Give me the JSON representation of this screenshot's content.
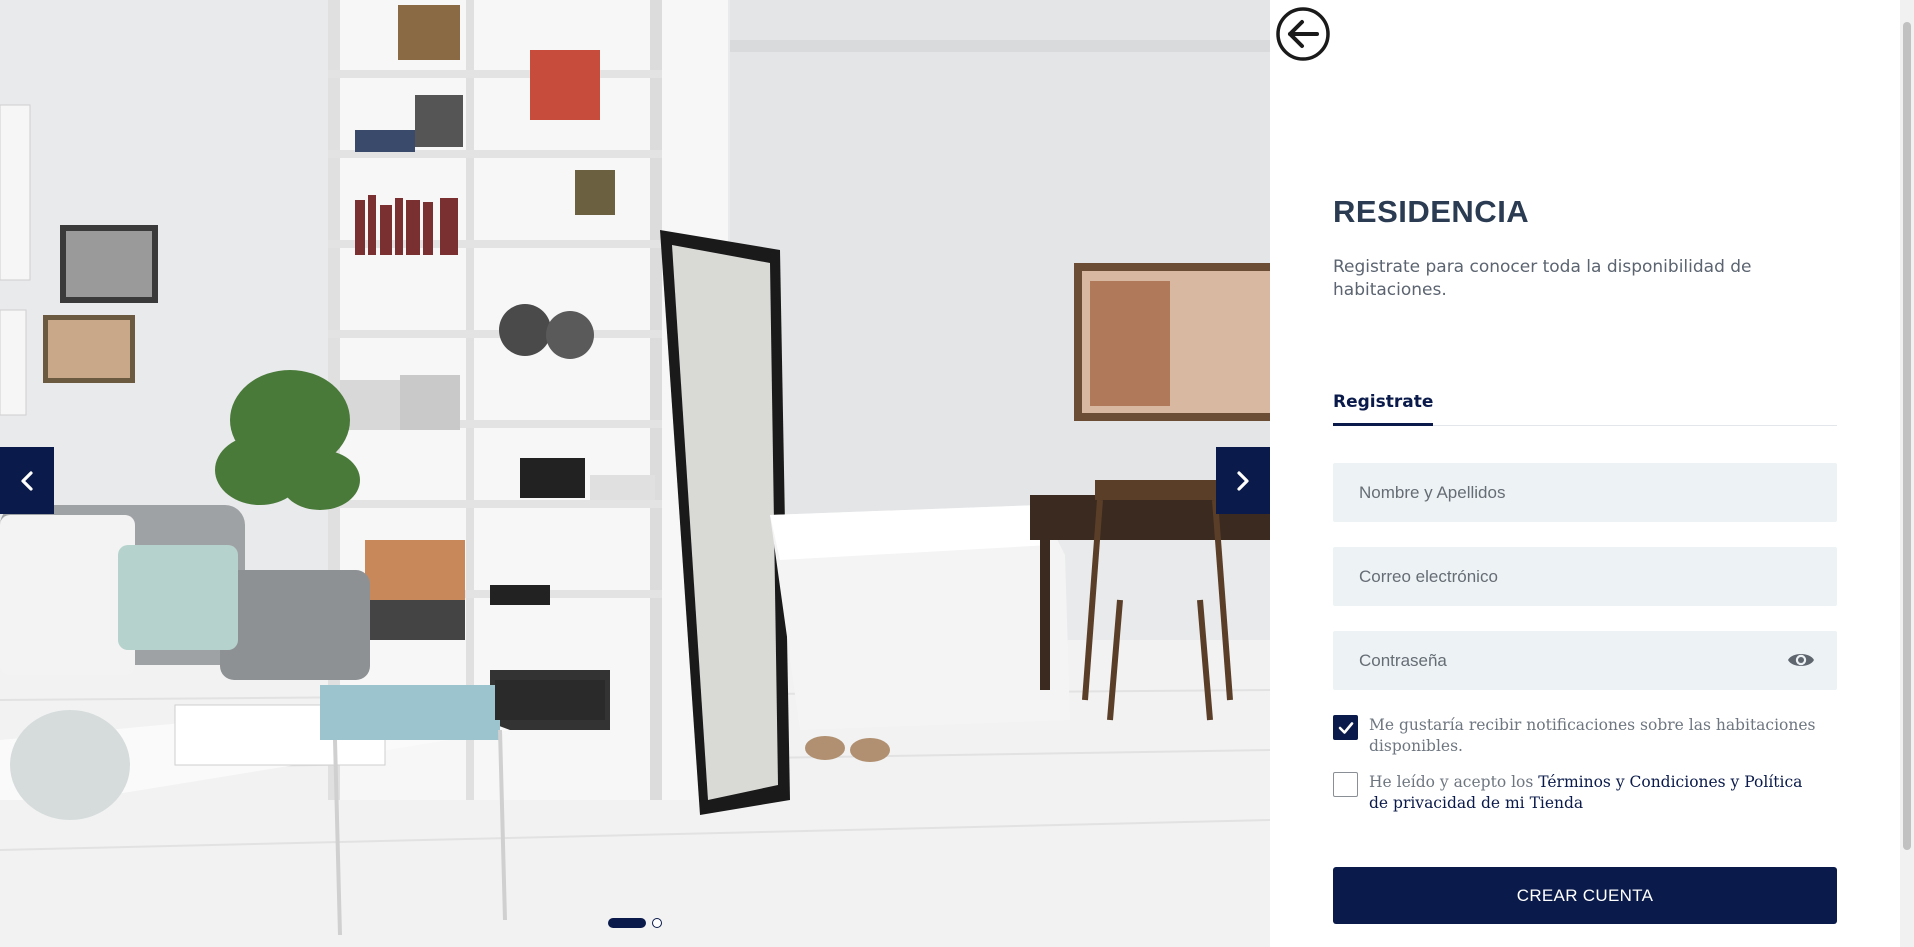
{
  "carousel": {
    "slides_total": 2,
    "active_slide": 1,
    "prev_icon": "chevron-left-icon",
    "next_icon": "chevron-right-icon"
  },
  "panel": {
    "back_icon": "arrow-left-circle-icon",
    "title": "RESIDENCIA",
    "subtitle": "Registrate para conocer toda la disponibilidad de habitaciones.",
    "tab_label": "Registrate",
    "name_placeholder": "Nombre y Apellidos",
    "email_placeholder": "Correo electrónico",
    "password_placeholder": "Contraseña",
    "password_toggle_icon": "eye-icon",
    "notify_checked": true,
    "notify_text": "Me gustaría recibir notificaciones sobre las habitaciones disponibles.",
    "terms_checked": false,
    "terms_prefix": "He leído y acepto los ",
    "terms_link": "Términos y Condiciones y Política de privacidad de mi Tienda",
    "submit_label": "CREAR CUENTA"
  },
  "colors": {
    "accent": "#0a1a4a",
    "title": "#2a3b52",
    "field_bg": "#edf3f5",
    "muted_text": "#6e7680"
  }
}
